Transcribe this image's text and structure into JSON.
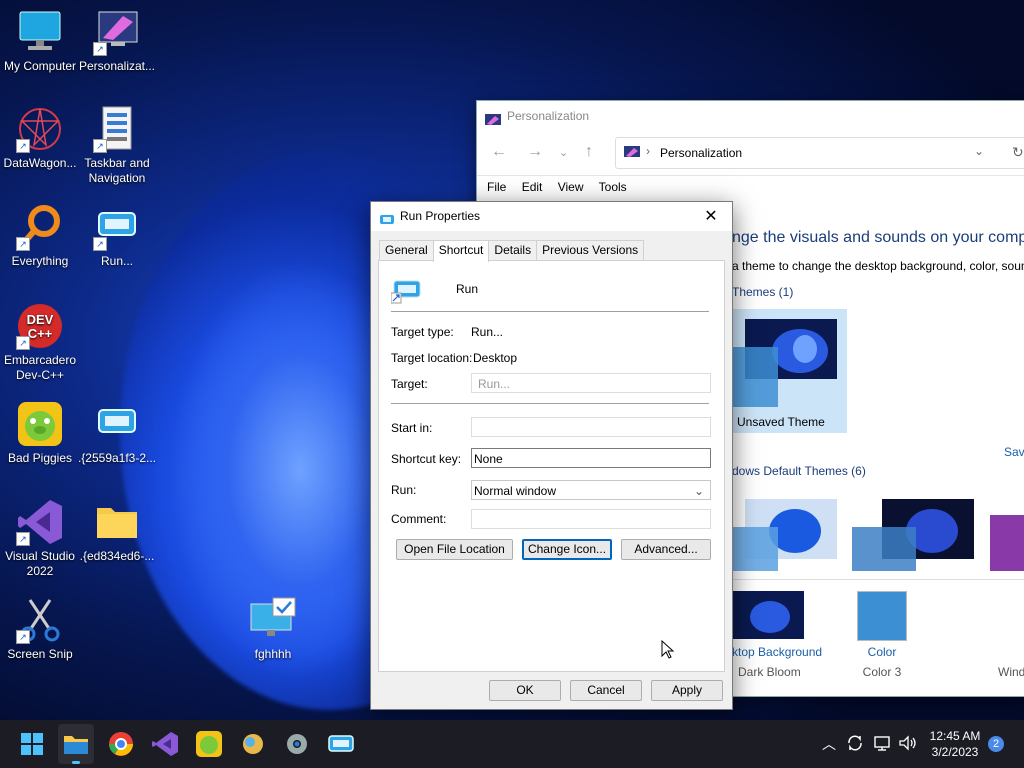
{
  "desktop": {
    "icons": [
      {
        "label": "My Computer"
      },
      {
        "label": "Personalizat..."
      },
      {
        "label": "DataWagon..."
      },
      {
        "label": "Taskbar and Navigation"
      },
      {
        "label": "Everything"
      },
      {
        "label": "Run..."
      },
      {
        "label": "Embarcadero Dev-C++"
      },
      {
        "label": "Bad Piggies"
      },
      {
        "label": ".{2559a1f3-2..."
      },
      {
        "label": "Visual Studio 2022"
      },
      {
        "label": ".{ed834ed6-..."
      },
      {
        "label": "Screen Snip"
      },
      {
        "label": "fghhhh"
      }
    ]
  },
  "explorer": {
    "title": "Personalization",
    "address": "Personalization",
    "menu": [
      "File",
      "Edit",
      "View",
      "Tools"
    ],
    "heading": "nge the visuals and sounds on your compu",
    "subheading": "a theme to change the desktop background, color, soun",
    "my_themes": "Themes (1)",
    "unsaved_theme": "Unsaved Theme",
    "save_link": "Sav",
    "default_themes": "dows Default Themes (6)",
    "desktop_background": "ktop Background",
    "desktop_background_sub": "Dark Bloom",
    "color": "Color",
    "color_sub": "Color 3",
    "window_label": "Wind"
  },
  "dialog": {
    "title": "Run Properties",
    "tabs": [
      "General",
      "Shortcut",
      "Details",
      "Previous Versions"
    ],
    "shortcut_name": "Run",
    "target_type_label": "Target type:",
    "target_type_value": "Run...",
    "target_location_label": "Target location:",
    "target_location_value": "Desktop",
    "target_label": "Target:",
    "target_value": "Run...",
    "start_in_label": "Start in:",
    "start_in_value": "",
    "shortcut_key_label": "Shortcut key:",
    "shortcut_key_value": "None",
    "run_label": "Run:",
    "run_value": "Normal window",
    "comment_label": "Comment:",
    "comment_value": "",
    "open_file_location": "Open File Location",
    "change_icon": "Change Icon...",
    "advanced": "Advanced...",
    "ok": "OK",
    "cancel": "Cancel",
    "apply": "Apply"
  },
  "taskbar": {
    "time": "12:45 AM",
    "date": "3/2/2023",
    "notifications": "2"
  },
  "colors": {
    "accent": "#0067c0",
    "taskbar": "#1c1c24",
    "selected_theme_bg": "#cce4f7"
  }
}
